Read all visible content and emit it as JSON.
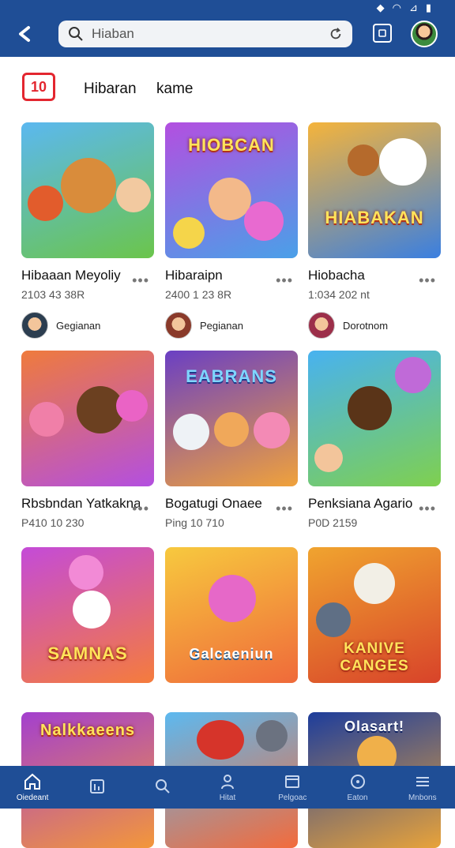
{
  "header": {
    "status_icons": [
      "signal-icon",
      "wifi-icon",
      "network-icon",
      "battery-icon"
    ],
    "search_text": "Hiaban",
    "avatar_name": "user-avatar"
  },
  "channel": {
    "logo_text": "10",
    "name": "Hibaran",
    "sub": "kame"
  },
  "cards": [
    {
      "title": "Hibaaan Meyoliy",
      "meta": "2103 43 38R",
      "author": "Gegianan",
      "thumb_title": "",
      "bg": [
        "#5bb8f0",
        "#6bc54b"
      ]
    },
    {
      "title": "Hibaraipn",
      "meta": "2400 1 23 8R",
      "author": "Pegianan",
      "thumb_title": "HIOBCAN",
      "bg": [
        "#b34fe0",
        "#4aa0e8"
      ]
    },
    {
      "title": "Hiobacha",
      "meta": "1:034 202 nt",
      "author": "Dorotnom",
      "thumb_title": "HIABAKAN",
      "bg": [
        "#f5b43b",
        "#3a7fe0"
      ]
    },
    {
      "title": "Rbsbndan Yatkakna",
      "meta": "P410 10 230",
      "author": "",
      "thumb_title": "",
      "bg": [
        "#ef7b3c",
        "#b34fe0"
      ]
    },
    {
      "title": "Bogatugi Onaee",
      "meta": "Ping 10 710",
      "author": "",
      "thumb_title": "EABRANS",
      "bg": [
        "#6a3fc4",
        "#f0a23b"
      ]
    },
    {
      "title": "Penksiana Agario",
      "meta": "P0D 2159",
      "author": "",
      "thumb_title": "",
      "bg": [
        "#48b2f0",
        "#7fd04f"
      ]
    },
    {
      "title": "",
      "meta": "",
      "author": "",
      "thumb_title": "SAMNAS",
      "bg": [
        "#c44bd8",
        "#f57c3c"
      ]
    },
    {
      "title": "",
      "meta": "",
      "author": "",
      "thumb_title": "Galcaeniun",
      "bg": [
        "#f7c93e",
        "#ef6a3a"
      ]
    },
    {
      "title": "",
      "meta": "",
      "author": "",
      "thumb_title": "KANIVE CANGES",
      "bg": [
        "#f0a42f",
        "#d8432a"
      ]
    },
    {
      "title": "",
      "meta": "",
      "author": "",
      "thumb_title": "Nalkkaeens",
      "bg": [
        "#a33fcf",
        "#f3973a"
      ]
    },
    {
      "title": "",
      "meta": "",
      "author": "",
      "thumb_title": "",
      "bg": [
        "#5cb9f0",
        "#f36b3c"
      ]
    },
    {
      "title": "",
      "meta": "",
      "author": "",
      "thumb_title": "Olasart!",
      "bg": [
        "#1d3d9c",
        "#e8a33a"
      ]
    }
  ],
  "more_label": "•••",
  "bottom_nav": [
    {
      "label": "Oiedeant",
      "icon": "home-icon"
    },
    {
      "label": "",
      "icon": "library-icon"
    },
    {
      "label": "",
      "icon": "search-icon"
    },
    {
      "label": "Hitat",
      "icon": "profile-icon"
    },
    {
      "label": "Pelgoac",
      "icon": "folder-icon"
    },
    {
      "label": "Eaton",
      "icon": "compass-icon"
    },
    {
      "label": "Mnbons",
      "icon": "menu-icon"
    }
  ]
}
